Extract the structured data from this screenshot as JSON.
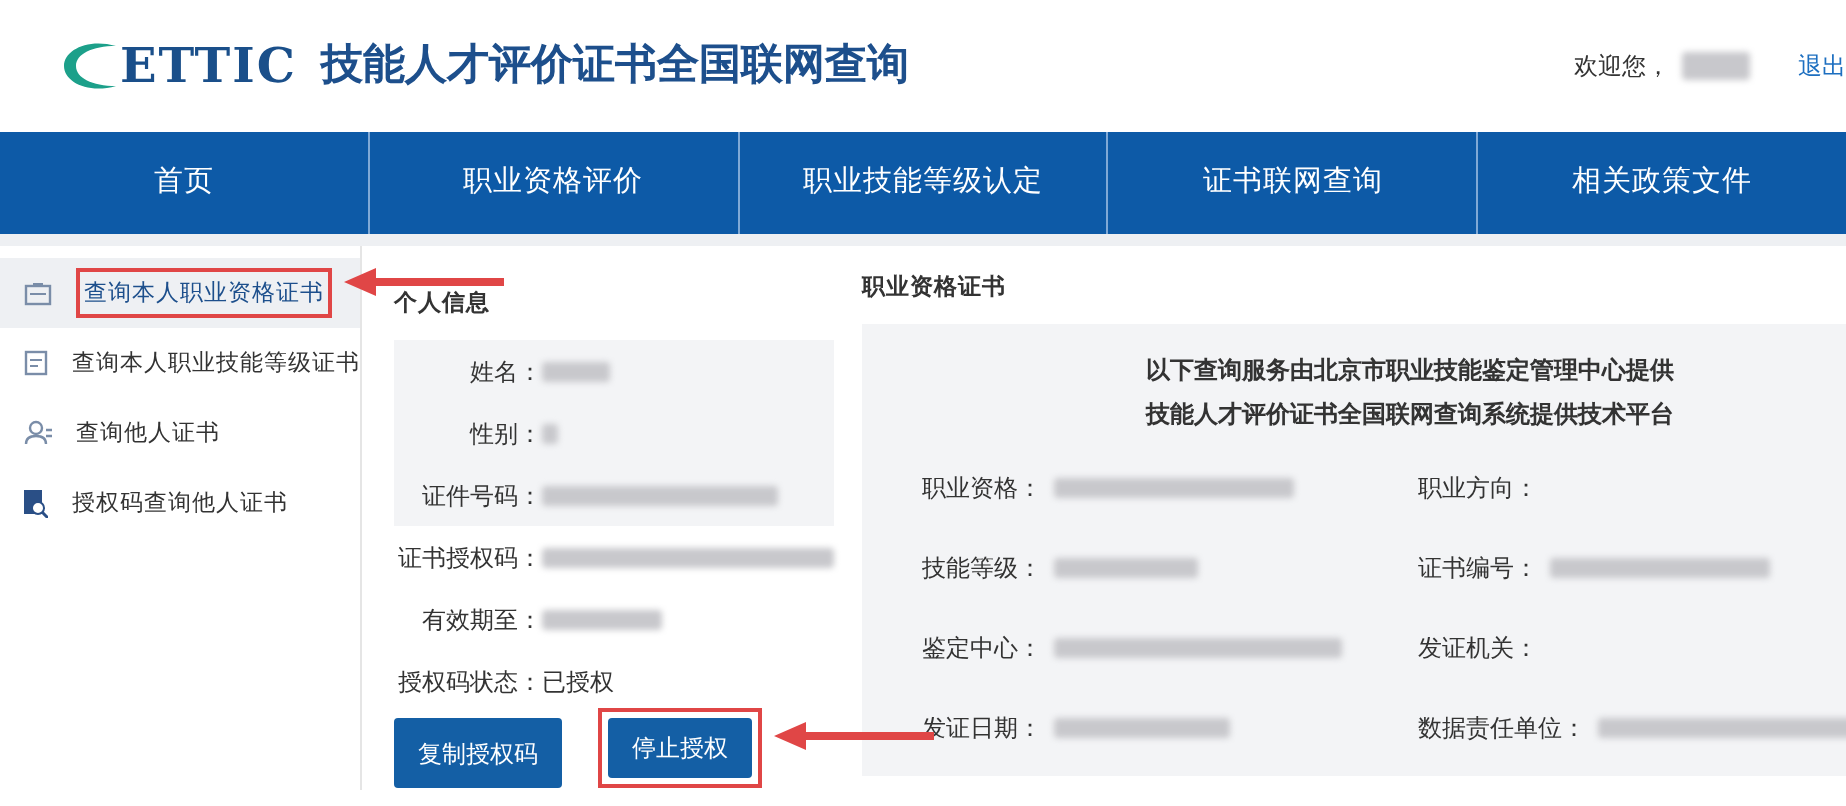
{
  "header": {
    "logo": "ETTIC",
    "title": "技能人才评价证书全国联网查询",
    "welcome": "欢迎您，",
    "logout": "退出"
  },
  "nav": [
    {
      "label": "首页"
    },
    {
      "label": "职业资格评价"
    },
    {
      "label": "职业技能等级认定"
    },
    {
      "label": "证书联网查询"
    },
    {
      "label": "相关政策文件"
    }
  ],
  "sidebar": {
    "items": [
      {
        "label": "查询本人职业资格证书",
        "selected": true,
        "highlighted": true
      },
      {
        "label": "查询本人职业技能等级证书",
        "selected": false,
        "highlighted": false
      },
      {
        "label": "查询他人证书",
        "selected": false,
        "highlighted": false
      },
      {
        "label": "授权码查询他人证书",
        "selected": false,
        "highlighted": false
      }
    ]
  },
  "personal": {
    "title": "个人信息",
    "fields": [
      {
        "label": "姓名：",
        "kind": "blurred",
        "shaded": true
      },
      {
        "label": "性别：",
        "kind": "blurred",
        "shaded": true
      },
      {
        "label": "证件号码：",
        "kind": "blurred",
        "shaded": true
      },
      {
        "label": "证书授权码：",
        "kind": "blurred",
        "shaded": false
      },
      {
        "label": "有效期至：",
        "kind": "blurred",
        "shaded": false
      },
      {
        "label": "授权码状态：",
        "kind": "text",
        "value": "已授权",
        "shaded": false
      }
    ],
    "buttons": [
      {
        "label": "复制授权码",
        "highlighted": false
      },
      {
        "label": "停止授权",
        "highlighted": true
      }
    ]
  },
  "certificate": {
    "title": "职业资格证书",
    "notice": [
      "以下查询服务由北京市职业技能鉴定管理中心提供",
      "技能人才评价证书全国联网查询系统提供技术平台"
    ],
    "fields": [
      {
        "label": "职业资格：",
        "kind": "blurred"
      },
      {
        "label": "职业方向：",
        "kind": "empty"
      },
      {
        "label": "技能等级：",
        "kind": "blurred"
      },
      {
        "label": "证书编号：",
        "kind": "blurred"
      },
      {
        "label": "鉴定中心：",
        "kind": "blurred"
      },
      {
        "label": "发证机关：",
        "kind": "empty"
      },
      {
        "label": "发证日期：",
        "kind": "blurred"
      },
      {
        "label": "数据责任单位：",
        "kind": "blurred"
      }
    ]
  }
}
